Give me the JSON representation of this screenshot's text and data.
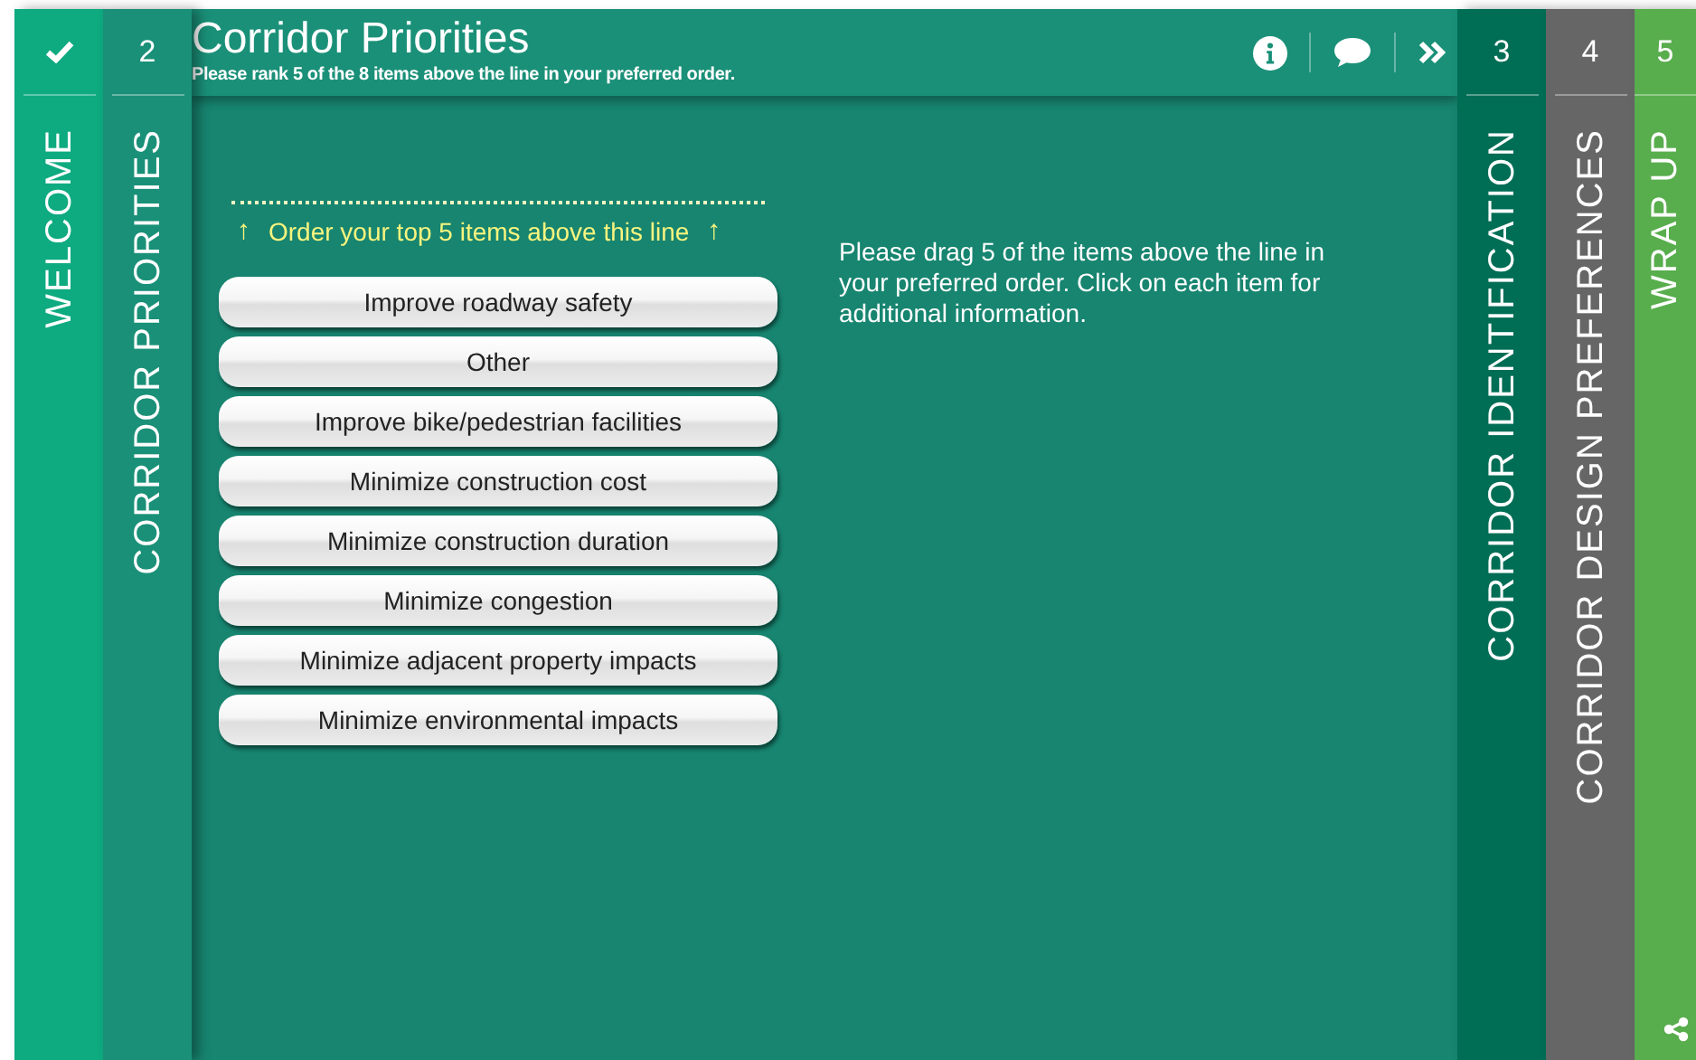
{
  "left_tabs": [
    {
      "label": "WELCOME",
      "completed": true,
      "color": "#0eaa80"
    },
    {
      "number": "2",
      "label": "CORRIDOR PRIORITIES",
      "completed": false,
      "color": "#1a9078"
    }
  ],
  "header": {
    "title": "Corridor Priorities",
    "subtitle": "Please rank 5 of the 8 items above the line in your preferred order."
  },
  "cut_line": {
    "arrow_left": "↑",
    "text": "Order your top 5 items above this line",
    "arrow_right": "↑"
  },
  "items": [
    "Improve roadway safety",
    "Other",
    "Improve bike/pedestrian facilities",
    "Minimize construction cost",
    "Minimize construction duration",
    "Minimize congestion",
    "Minimize adjacent property impacts",
    "Minimize environmental impacts"
  ],
  "instructions": "Please drag 5 of the items above the line in your preferred order. Click on each item for additional information.",
  "right_tabs": [
    {
      "number": "3",
      "label": "CORRIDOR IDENTIFICATION",
      "completed": false,
      "color": "#006d55"
    },
    {
      "number": "4",
      "label": "CORRIDOR DESIGN PREFERENCES",
      "completed": false,
      "color": "#666666"
    },
    {
      "number": "5",
      "label": "WRAP UP",
      "completed": false,
      "color": "#58ad4d"
    }
  ]
}
